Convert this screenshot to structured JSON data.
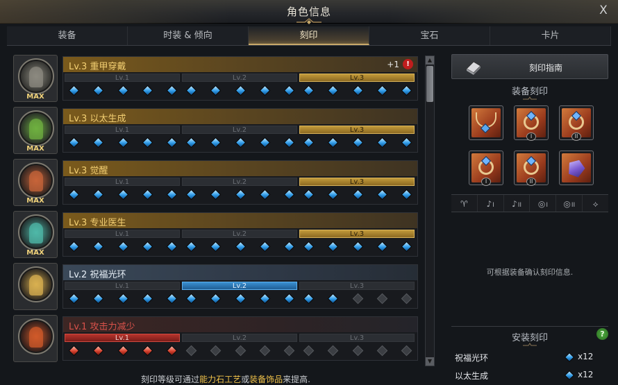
{
  "window": {
    "title": "角色信息",
    "close_label": "X"
  },
  "tabs": [
    {
      "label": "装备"
    },
    {
      "label": "时装 & 倾向"
    },
    {
      "label": "刻印",
      "active": true
    },
    {
      "label": "宝石"
    },
    {
      "label": "卡片"
    }
  ],
  "engravings": [
    {
      "name": "Lv.3 重甲穿戴",
      "style": "gold",
      "max": "MAX",
      "plus": "+1",
      "alert": "!",
      "active_level": 3,
      "gem_color": "blue",
      "filled": 15,
      "levels": [
        "Lv.1",
        "Lv.2",
        "Lv.3"
      ]
    },
    {
      "name": "Lv.3 以太生成",
      "style": "gold",
      "max": "MAX",
      "active_level": 3,
      "gem_color": "blue",
      "filled": 15,
      "levels": [
        "Lv.1",
        "Lv.2",
        "Lv.3"
      ]
    },
    {
      "name": "Lv.3 觉醒",
      "style": "gold",
      "max": "MAX",
      "active_level": 3,
      "gem_color": "blue",
      "filled": 15,
      "levels": [
        "Lv.1",
        "Lv.2",
        "Lv.3"
      ]
    },
    {
      "name": "Lv.3 专业医生",
      "style": "gold",
      "max": "MAX",
      "active_level": 3,
      "gem_color": "blue",
      "filled": 15,
      "levels": [
        "Lv.1",
        "Lv.2",
        "Lv.3"
      ]
    },
    {
      "name": "Lv.2 祝福光环",
      "style": "blue",
      "max": "",
      "active_level": 2,
      "gem_color": "blue",
      "filled": 12,
      "levels": [
        "Lv.1",
        "Lv.2",
        "Lv.3"
      ]
    },
    {
      "name": "Lv.1 攻击力减少",
      "style": "red",
      "max": "",
      "active_level": 1,
      "gem_color": "red",
      "filled": 5,
      "levels": [
        "Lv.1",
        "Lv.2",
        "Lv.3"
      ]
    }
  ],
  "footer": {
    "prefix": "刻印等级可通过",
    "link1": "能力石工艺",
    "mid": "或",
    "link2": "装备饰品",
    "suffix": "来提高."
  },
  "right_panel": {
    "guide_button": "刻印指南",
    "equip_title": "装备刻印",
    "equip_slots": [
      {
        "item": "necklace-icon",
        "roman": ""
      },
      {
        "item": "earring-icon",
        "roman": "I"
      },
      {
        "item": "earring-icon",
        "roman": "II"
      },
      {
        "item": "ring-icon",
        "roman": "I"
      },
      {
        "item": "ring-icon",
        "roman": "II"
      },
      {
        "item": "stone-icon",
        "roman": ""
      }
    ],
    "filters": [
      {
        "icon": "necklace-filter-icon",
        "glyph": "♈",
        "sub": ""
      },
      {
        "icon": "earring-filter-icon",
        "glyph": "♪",
        "sub": "I"
      },
      {
        "icon": "earring-filter-icon",
        "glyph": "♪",
        "sub": "II"
      },
      {
        "icon": "ring-filter-icon",
        "glyph": "◎",
        "sub": "I"
      },
      {
        "icon": "ring-filter-icon",
        "glyph": "◎",
        "sub": "II"
      },
      {
        "icon": "stone-filter-icon",
        "glyph": "⟡",
        "sub": ""
      }
    ],
    "equip_hint": "可根据装备确认刻印信息.",
    "install_title": "安装刻印",
    "help": "?",
    "installed": [
      {
        "name": "祝福光环",
        "count": "x12"
      },
      {
        "name": "以太生成",
        "count": "x12"
      }
    ]
  },
  "colors": {
    "gold_accent": "#f3cf72",
    "blue_gem": "#2f9be8",
    "red_warning": "#d9524a",
    "highlight": "#f0c24a"
  }
}
